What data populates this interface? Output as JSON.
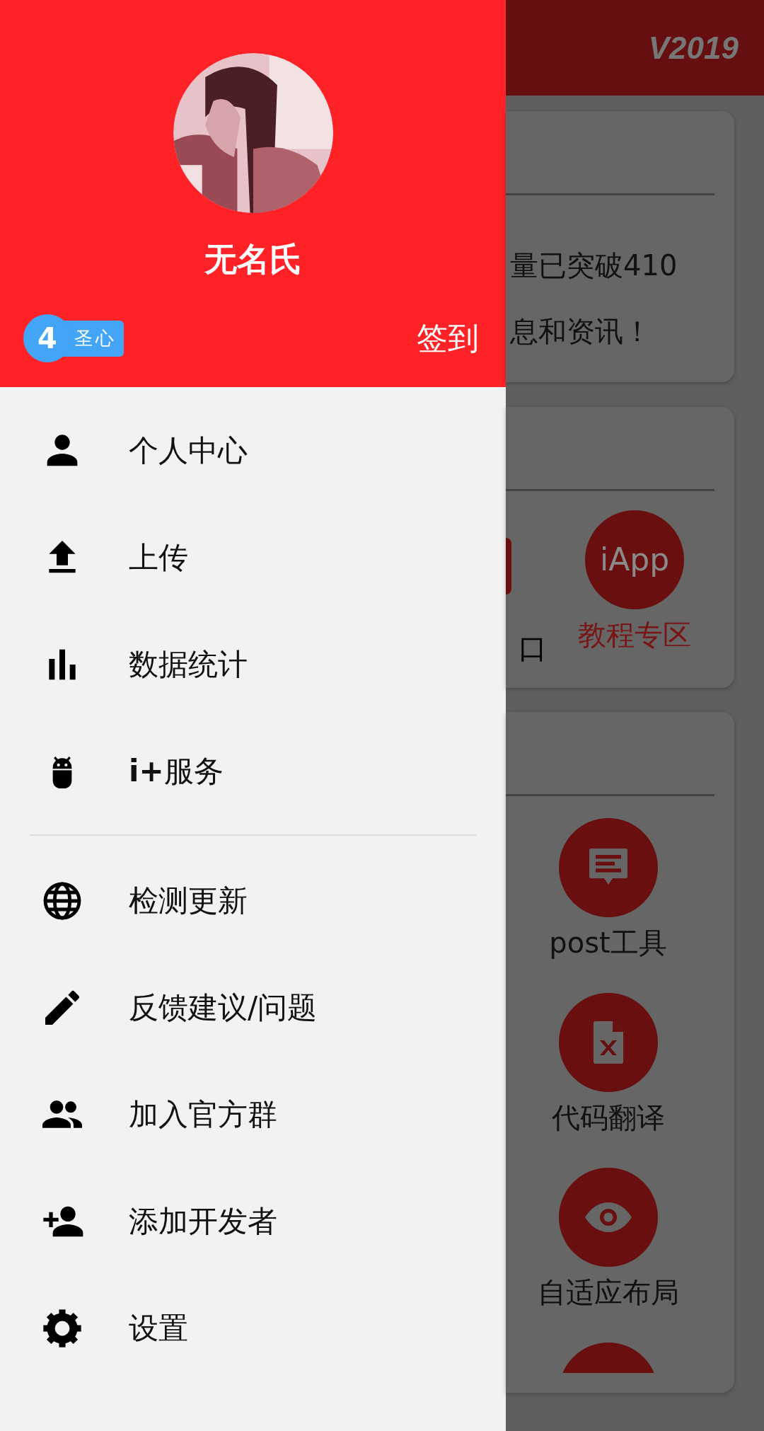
{
  "app_bar": {
    "version": "V2019"
  },
  "drawer": {
    "header": {
      "username": "无名氏",
      "badge": {
        "number": "4",
        "title": "圣心"
      },
      "checkin_button": "签到"
    },
    "menu_sections": [
      [
        {
          "label": "个人中心"
        },
        {
          "label": "上传"
        },
        {
          "label": "数据统计"
        },
        {
          "label": "**i+**服务"
        }
      ],
      [
        {
          "label": "检测更新"
        },
        {
          "label": "反馈建议/问题"
        },
        {
          "label": "加入官方群"
        },
        {
          "label": "添加开发者"
        },
        {
          "label": "设置"
        }
      ]
    ]
  },
  "cards": [
    {
      "kind": "notice",
      "lines": [
        "量已突破410",
        "息和资讯！"
      ]
    },
    {
      "kind": "tiles",
      "tiles": [
        {
          "kind": "partial",
          "label": "口",
          "color": "#000000"
        },
        {
          "kind": "text",
          "icon_text": "iApp",
          "label": "教程专区",
          "color": "#7a1516"
        }
      ]
    },
    {
      "kind": "tools",
      "tiles": [
        {
          "kind": "tool",
          "label": "post工具"
        },
        {
          "kind": "tool",
          "label": "代码翻译"
        },
        {
          "kind": "tool",
          "label": "自适应布局"
        },
        {
          "kind": "cut"
        }
      ]
    }
  ]
}
